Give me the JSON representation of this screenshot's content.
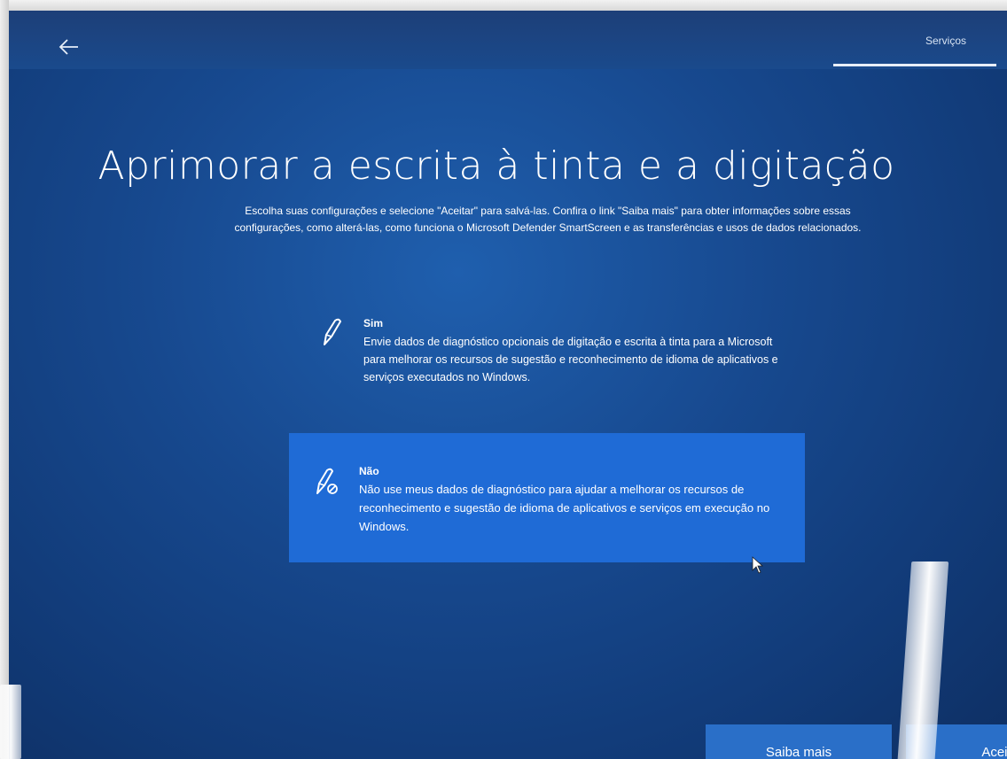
{
  "header": {
    "back_icon": "arrow-left-icon",
    "nav_label": "Serviços"
  },
  "main": {
    "title": "Aprimorar a escrita à tinta e a digitação",
    "subtitle_line1": "Escolha suas configurações e selecione \"Aceitar\" para salvá-las. Confira o link \"Saiba mais\" para obter informações sobre essas",
    "subtitle_line2": "configurações, como alterá-las, como funciona o Microsoft Defender SmartScreen e as transferências e usos de dados relacionados."
  },
  "options": {
    "yes": {
      "icon": "pen-icon",
      "title": "Sim",
      "description": "Envie dados de diagnóstico opcionais de digitação e escrita à tinta para a Microsoft para melhorar os recursos de sugestão e reconhecimento de idioma de aplicativos e serviços executados no Windows."
    },
    "no": {
      "icon": "pen-blocked-icon",
      "title": "Não",
      "description": "Não use meus dados de diagnóstico para ajudar a melhorar os recursos de reconhecimento e sugestão de idioma de aplicativos e serviços em execução no Windows.",
      "selected": true
    }
  },
  "footer": {
    "learn_more_label": "Saiba mais",
    "accept_label": "Aceitar"
  },
  "colors": {
    "background": "#17498f",
    "selected_option": "#1f6bd6",
    "button": "#2a6fc8",
    "text": "#ffffff"
  }
}
